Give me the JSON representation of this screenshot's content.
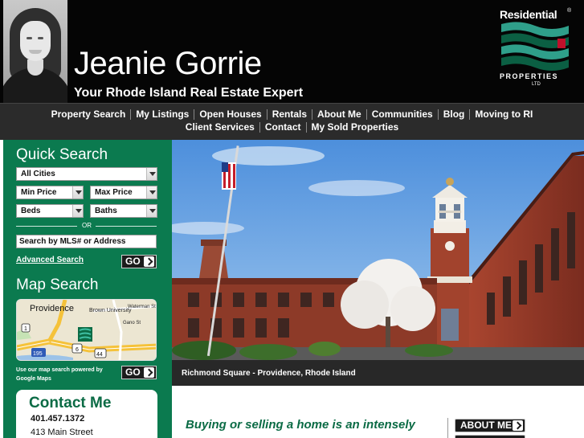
{
  "header": {
    "agent_name": "Jeanie Gorrie",
    "tagline": "Your Rhode Island Real Estate Expert",
    "brand": {
      "wordmark": "Residential",
      "reg_mark": "®",
      "properties": "PROPERTIES",
      "ltd": "LTD",
      "colors": {
        "teal": "#2f9f8a",
        "dark_green": "#0b5f43",
        "black": "#050505"
      }
    }
  },
  "nav": {
    "row1": [
      "Property Search",
      "My Listings",
      "Open Houses",
      "Rentals",
      "About Me",
      "Communities",
      "Blog",
      "Moving to RI"
    ],
    "row2": [
      "Client Services",
      "Contact",
      "My Sold Properties"
    ]
  },
  "sidebar": {
    "quick_search_title": "Quick Search",
    "city_select": "All Cities",
    "min_price": "Min Price",
    "max_price": "Max Price",
    "beds": "Beds",
    "baths": "Baths",
    "or_text": "OR",
    "mls_input_value": "Search by MLS# or Address",
    "advanced_search": "Advanced Search",
    "go_label": "GO",
    "map_search_title": "Map Search",
    "map": {
      "city": "Providence",
      "university": "Brown University",
      "street1": "Waterman St",
      "street2": "Gano St",
      "route1": "1",
      "route2": "195",
      "route3": "6",
      "route4": "44"
    },
    "map_note": "Use our map search powered by Google Maps",
    "contact": {
      "title": "Contact Me",
      "phone": "401.457.1372",
      "address": "413 Main Street"
    }
  },
  "hero": {
    "caption": "Richmond Square - Providence, Rhode Island"
  },
  "main": {
    "intro_text": "Buying or selling a home is an intensely",
    "about_button": "ABOUT ME"
  },
  "colors": {
    "sidebar_green": "#0b7a4f",
    "heading_green": "#0b6b45",
    "nav_bg": "#2b2b2b",
    "header_bg": "#050505"
  }
}
